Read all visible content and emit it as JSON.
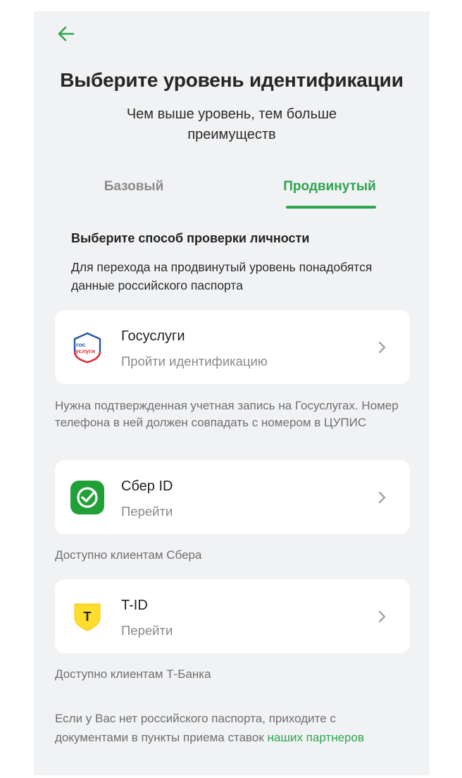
{
  "header": {
    "title": "Выберите уровень идентификации",
    "subtitle": "Чем выше уровень, тем больше преимуществ"
  },
  "tabs": [
    {
      "label": "Базовый",
      "active": false
    },
    {
      "label": "Продвинутый",
      "active": true
    }
  ],
  "section": {
    "title": "Выберите способ проверки личности",
    "description": "Для перехода на продвинутый уровень понадобятся данные российского паспорта"
  },
  "options": [
    {
      "title": "Госуслуги",
      "subtitle": "Пройти идентификацию",
      "icon": "gosuslugi-logo",
      "logo_text_top": "гос",
      "logo_text_bottom": "услуги",
      "note": "Нужна подтвержденная учетная запись на Госуслугах. Номер телефона в ней должен совпадать с номером в ЦУПИС"
    },
    {
      "title": "Сбер ID",
      "subtitle": "Перейти",
      "icon": "sber-logo",
      "note": "Доступно клиентам Сбера"
    },
    {
      "title": "T-ID",
      "subtitle": "Перейти",
      "icon": "tbank-logo",
      "logo_text": "Т",
      "note": "Доступно клиентам Т-Банка"
    }
  ],
  "footer": {
    "text": "Если у Вас нет российского паспорта, приходите с документами в пункты приема ставок ",
    "link": "наших партнеров"
  },
  "colors": {
    "accent": "#2ea44f",
    "background": "#f1f2f4",
    "card": "#ffffff",
    "sber": "#21a038",
    "tbank": "#ffdd2d"
  }
}
